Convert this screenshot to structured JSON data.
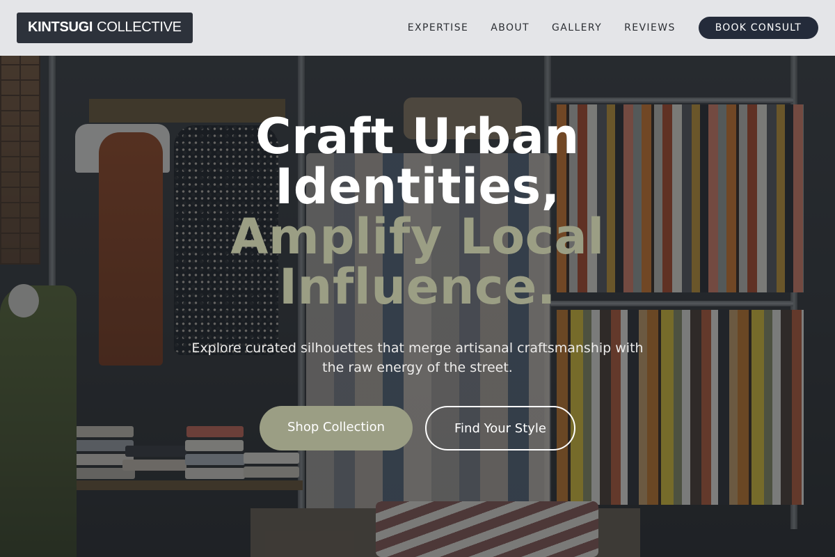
{
  "brand": {
    "name_strong": "KINTSUGI",
    "name_light": "COLLECTIVE"
  },
  "nav": {
    "items": [
      {
        "label": "EXPERTISE"
      },
      {
        "label": "ABOUT"
      },
      {
        "label": "GALLERY"
      },
      {
        "label": "REVIEWS"
      }
    ],
    "cta_label": "BOOK CONSULT"
  },
  "hero": {
    "headline_white_1": "Craft Urban",
    "headline_white_2": "Identities,",
    "headline_sage_1": "Amplify Local",
    "headline_sage_2": "Influence.",
    "subtitle": "Explore curated silhouettes that merge artisanal craftsmanship with the raw energy of the street.",
    "primary_cta": "Shop Collection",
    "secondary_cta": "Find Your Style",
    "background_image": "clothing-store-interior-photo"
  },
  "colors": {
    "accent_sage": "#9b9e84",
    "navy_button": "#242b3a",
    "logo_bg": "#2d323b",
    "header_bg": "#ecedef"
  }
}
